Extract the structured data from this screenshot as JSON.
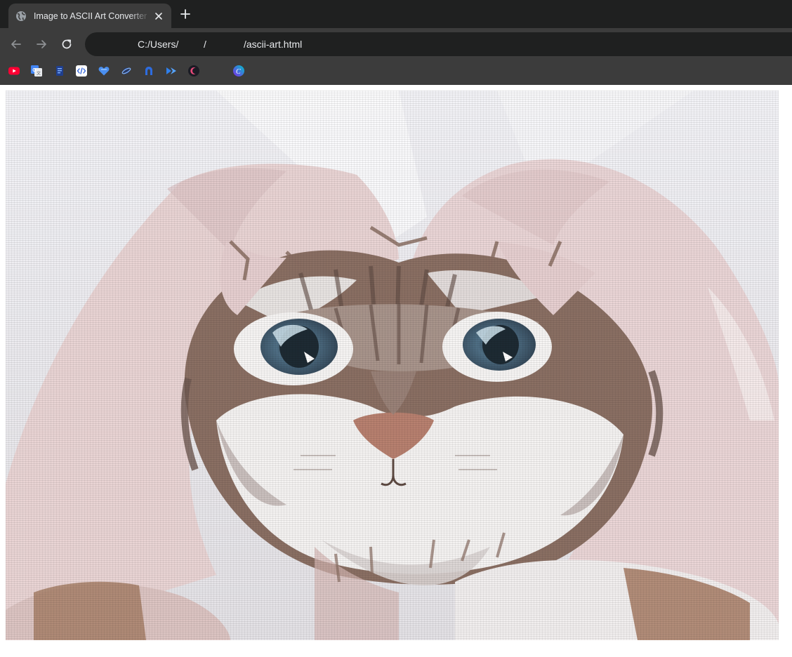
{
  "browser": {
    "tab": {
      "title": "Image to ASCII Art Converter Ex",
      "favicon": "globe-icon",
      "close_icon": "close-icon"
    },
    "new_tab_icon": "plus-icon",
    "nav": {
      "back_icon": "arrow-left-icon",
      "forward_icon": "arrow-right-icon",
      "reload_icon": "reload-icon"
    },
    "address": {
      "part1": "C:/Users/",
      "part2": "/",
      "part3": "/ascii-art.html"
    },
    "bookmarks": [
      {
        "name": "youtube-icon",
        "color": "#ff0033"
      },
      {
        "name": "google-translate-icon",
        "color": "#4285f4"
      },
      {
        "name": "document-app-icon",
        "color": "#3b6fe0"
      },
      {
        "name": "code-editor-icon",
        "color": "#ffffff"
      },
      {
        "name": "heart-shield-icon",
        "color": "#3b82f6"
      },
      {
        "name": "orbit-icon",
        "color": "#5b8def"
      },
      {
        "name": "dark-logo-icon",
        "color": "#2d6cdf"
      },
      {
        "name": "chevron-logo-icon",
        "color": "#2f80ed"
      },
      {
        "name": "moon-logo-icon",
        "color": "#e84a7a"
      },
      {
        "name": "canva-icon",
        "color": "#7d2ae8"
      }
    ]
  },
  "content": {
    "image": "ascii-art-cat-in-hands",
    "colors": {
      "background": "#e8e4e8",
      "hands": "#e9d4d4",
      "fur_dark": "#8a6f63",
      "fur_light": "#f1efee",
      "eyes": "#4f6f85",
      "nose": "#b7806f"
    }
  }
}
